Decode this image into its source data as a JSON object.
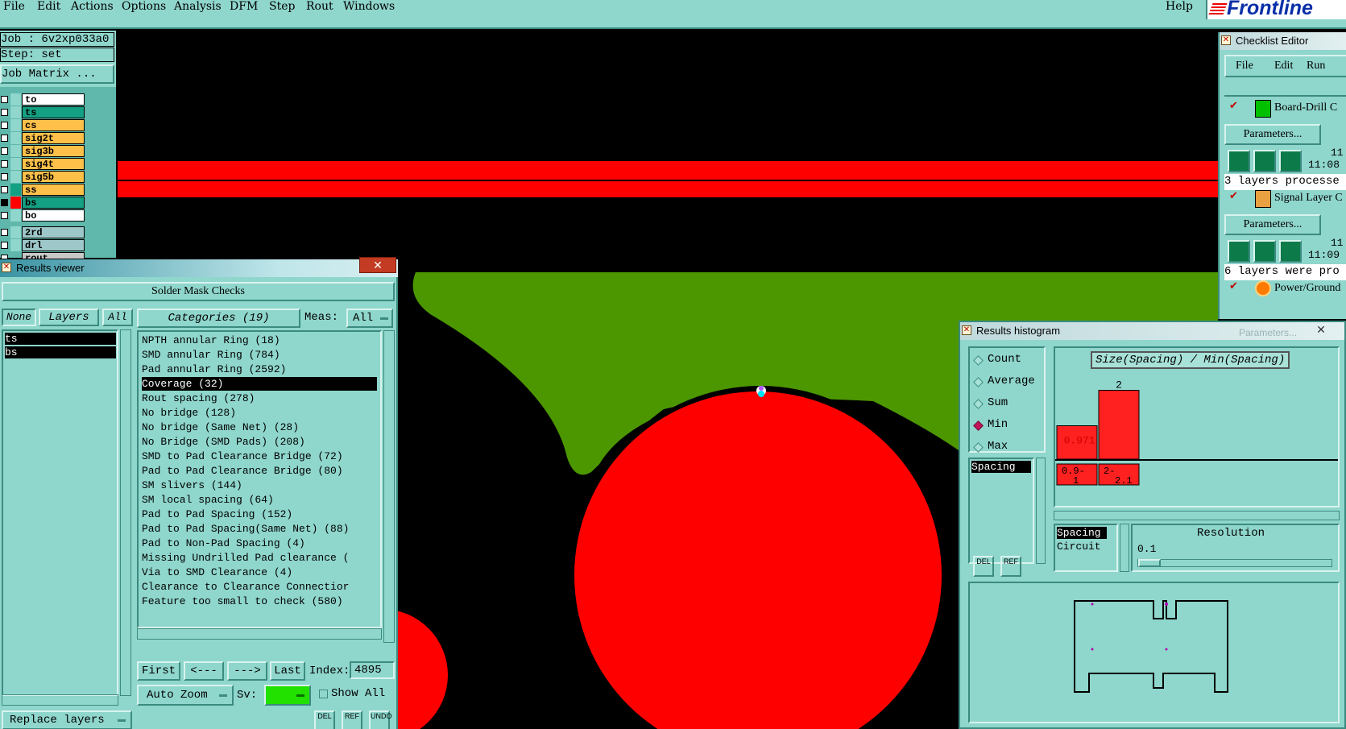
{
  "menubar": {
    "items": [
      "File",
      "Edit",
      "Actions",
      "Options",
      "Analysis",
      "DFM",
      "Step",
      "Rout",
      "Windows"
    ],
    "help": "Help",
    "logo": "Frontline"
  },
  "job": {
    "job_label": "Job : 6v2xp033a0",
    "step_label": "Step: set",
    "matrix_button": "Job Matrix ..."
  },
  "layers": [
    {
      "name": "to",
      "color": "#ffffff",
      "swatch": "#8fd6cc"
    },
    {
      "name": "ts",
      "color": "#14a082",
      "swatch": "#8fd6cc"
    },
    {
      "name": "cs",
      "color": "#ffc04a",
      "swatch": "#8fd6cc"
    },
    {
      "name": "sig2t",
      "color": "#ffc04a",
      "swatch": "#8fd6cc"
    },
    {
      "name": "sig3b",
      "color": "#ffc04a",
      "swatch": "#8fd6cc"
    },
    {
      "name": "sig4t",
      "color": "#ffc04a",
      "swatch": "#8fd6cc"
    },
    {
      "name": "sig5b",
      "color": "#ffc04a",
      "swatch": "#8fd6cc"
    },
    {
      "name": "ss",
      "color": "#ffc04a",
      "swatch": "#14a082"
    },
    {
      "name": "bs",
      "color": "#14a082",
      "swatch": "#ff0000"
    },
    {
      "name": "bo",
      "color": "#ffffff",
      "swatch": "#8fd6cc"
    }
  ],
  "drill_layers": [
    "2rd",
    "drl",
    "rout"
  ],
  "results_viewer": {
    "title": "Results viewer",
    "heading": "Solder Mask Checks",
    "none_btn": "None",
    "layers_btn": "Layers",
    "all_btn": "All",
    "layer_list": [
      "ts",
      "bs"
    ],
    "categories_btn": "Categories (19)",
    "meas_label": "Meas:",
    "meas_value": "All",
    "categories": [
      "NPTH annular Ring (18)",
      "SMD annular Ring (784)",
      "Pad annular Ring (2592)",
      "Coverage (32)",
      "Rout spacing (278)",
      "No bridge (128)",
      "No bridge (Same Net) (28)",
      "No Bridge (SMD Pads) (208)",
      "SMD to Pad Clearance Bridge (72)",
      "Pad to Pad Clearance Bridge (80)",
      "SM slivers (144)",
      "SM local spacing (64)",
      "Pad to Pad Spacing (152)",
      "Pad to Pad Spacing(Same Net) (88)",
      "Pad to Non-Pad Spacing (4)",
      "Missing Undrilled Pad clearance (",
      "Via to SMD Clearance (4)",
      "Clearance to Clearance Connectior",
      "Feature too small to check (580)"
    ],
    "selected_index": 3,
    "first_btn": "First",
    "prev_btn": "<---",
    "next_btn": "--->",
    "last_btn": "Last",
    "index_label": "Index:",
    "index_value": "4895",
    "zoom_option": "Auto Zoom",
    "sv_label": "Sv:",
    "show_all_label": "Show All",
    "replace_layers": "Replace layers",
    "del_label": "DEL",
    "ref_label": "REF",
    "undo_label": "UNDO"
  },
  "checklist_editor": {
    "title": "Checklist Editor",
    "menu": [
      "File",
      "Edit",
      "Run"
    ],
    "checks": [
      {
        "name": "Board-Drill C",
        "params": "Parameters...",
        "time_top": "11",
        "time": "11:08",
        "status": "3 layers processe"
      },
      {
        "name": "Signal Layer C",
        "params": "Parameters...",
        "time_top": "11",
        "time": "11:09",
        "status": "6 layers were pro"
      },
      {
        "name": "Power/Ground",
        "params": "",
        "time_top": "",
        "time": "",
        "status": ""
      }
    ],
    "ghost_label": "Parameters..."
  },
  "histogram": {
    "title": "Results histogram",
    "modes": [
      "Count",
      "Average",
      "Sum",
      "Min",
      "Max"
    ],
    "selected_mode": "Min",
    "measure_list": [
      "Spacing"
    ],
    "chart_title": "Size(Spacing) / Min(Spacing)",
    "del_label": "DEL",
    "ref_label": "REF",
    "group_list": [
      "Spacing",
      "Circuit"
    ],
    "resolution_label": "Resolution",
    "resolution_value": "0.1"
  },
  "chart_data": {
    "type": "bar",
    "title": "Size(Spacing) / Min(Spacing)",
    "categories": [
      "0.9-1",
      "2-2.1"
    ],
    "values": [
      0.971,
      2
    ],
    "value_labels": [
      "0.971",
      "2"
    ],
    "bin_labels": [
      [
        "0.9-",
        "1"
      ],
      [
        "2-",
        "2.1"
      ]
    ],
    "ylim": [
      0,
      2.2
    ],
    "bar_color": "#ff2020"
  },
  "colors": {
    "panel": "#8fd6cc",
    "menubar": "#8fd6cc",
    "solder_mask": "#4c9700",
    "copper": "#ff0000",
    "background": "#000000"
  }
}
